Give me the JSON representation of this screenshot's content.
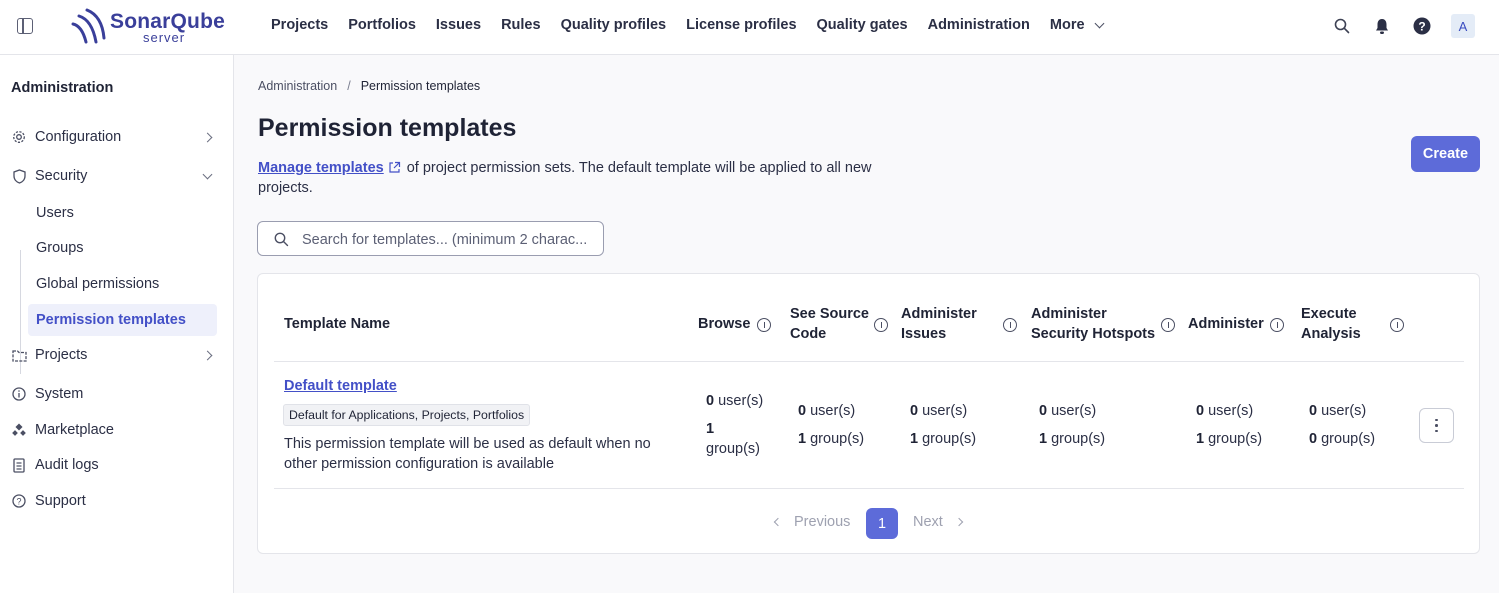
{
  "header": {
    "logo_name": "SonarQube",
    "logo_sub": "server",
    "nav": [
      "Projects",
      "Portfolios",
      "Issues",
      "Rules",
      "Quality profiles",
      "License profiles",
      "Quality gates",
      "Administration"
    ],
    "more_label": "More",
    "avatar_letter": "A"
  },
  "sidebar": {
    "title": "Administration",
    "items": [
      {
        "label": "Configuration",
        "icon": "gear-icon"
      },
      {
        "label": "Security",
        "icon": "shield-icon"
      },
      {
        "label": "Projects",
        "icon": "projects-icon"
      },
      {
        "label": "System",
        "icon": "info-icon"
      },
      {
        "label": "Marketplace",
        "icon": "marketplace-icon"
      },
      {
        "label": "Audit logs",
        "icon": "audit-icon"
      },
      {
        "label": "Support",
        "icon": "help-icon"
      }
    ],
    "security_sub": [
      "Users",
      "Groups",
      "Global permissions",
      "Permission templates"
    ],
    "active": "Permission templates"
  },
  "breadcrumb": {
    "parent": "Administration",
    "sep": "/",
    "current": "Permission templates"
  },
  "page": {
    "title": "Permission templates",
    "desc_link": "Manage templates",
    "desc_text": "of project permission sets. The default template will be applied to all new projects.",
    "create_label": "Create",
    "search_placeholder": "Search for templates... (minimum 2 charac..."
  },
  "table": {
    "headers": {
      "name": "Template Name",
      "browse": "Browse",
      "see_source_1": "See Source",
      "see_source_2": "Code",
      "admin_issues_1": "Administer",
      "admin_issues_2": "Issues",
      "admin_hotspots_1": "Administer",
      "admin_hotspots_2": "Security Hotspots",
      "administer": "Administer",
      "execute_1": "Execute",
      "execute_2": "Analysis"
    },
    "row": {
      "name": "Default template",
      "badge": "Default for Applications, Projects, Portfolios",
      "description": "This permission template will be used as default when no other permission configuration is available",
      "users_suffix": "user(s)",
      "groups_suffix": "group(s)",
      "browse_users": "0",
      "browse_groups": "1",
      "source_users": "0",
      "source_groups": "1",
      "issues_users": "0",
      "issues_groups": "1",
      "hotspots_users": "0",
      "hotspots_groups": "1",
      "admin_users": "0",
      "admin_groups": "1",
      "execute_users": "0",
      "execute_groups": "0"
    }
  },
  "pagination": {
    "previous": "Previous",
    "current": "1",
    "next": "Next"
  },
  "colors": {
    "accent": "#5d6bd9",
    "link": "#4350c7",
    "brand": "#3a3f9a"
  }
}
